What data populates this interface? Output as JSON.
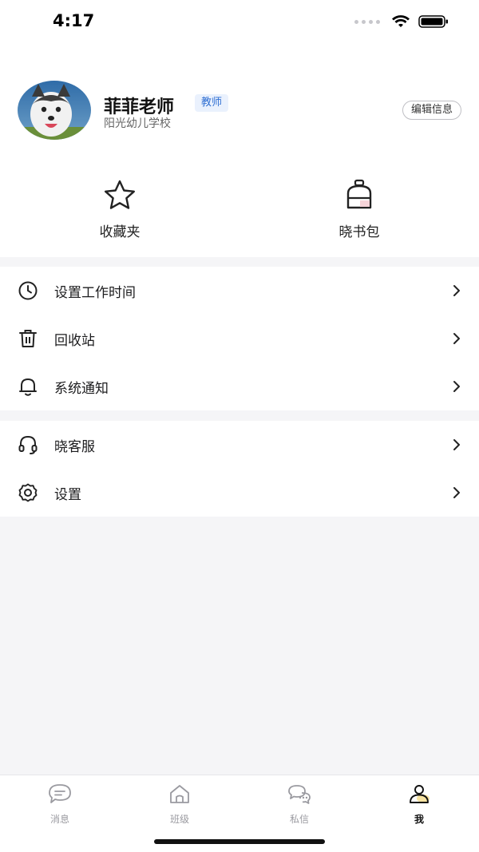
{
  "status_bar": {
    "time": "4:17"
  },
  "profile": {
    "name": "菲菲老师",
    "role": "教师",
    "school": "阳光幼儿学校",
    "edit_label": "编辑信息"
  },
  "quick_actions": [
    {
      "label": "收藏夹",
      "icon": "star-icon"
    },
    {
      "label": "晓书包",
      "icon": "schoolbag-icon"
    }
  ],
  "menu_group_1": [
    {
      "label": "设置工作时间",
      "icon": "clock-icon"
    },
    {
      "label": "回收站",
      "icon": "trash-icon"
    },
    {
      "label": "系统通知",
      "icon": "bell-icon"
    }
  ],
  "menu_group_2": [
    {
      "label": "晓客服",
      "icon": "headset-icon"
    },
    {
      "label": "设置",
      "icon": "gear-icon"
    }
  ],
  "tabbar": [
    {
      "label": "消息",
      "icon": "message-icon",
      "active": false
    },
    {
      "label": "班级",
      "icon": "home-icon",
      "active": false
    },
    {
      "label": "私信",
      "icon": "chat-icon",
      "active": false
    },
    {
      "label": "我",
      "icon": "user-icon",
      "active": true
    }
  ],
  "colors": {
    "accent_badge": "#2f6fd3",
    "active_tab": "#111111",
    "inactive_tab": "#9a9aa0"
  }
}
